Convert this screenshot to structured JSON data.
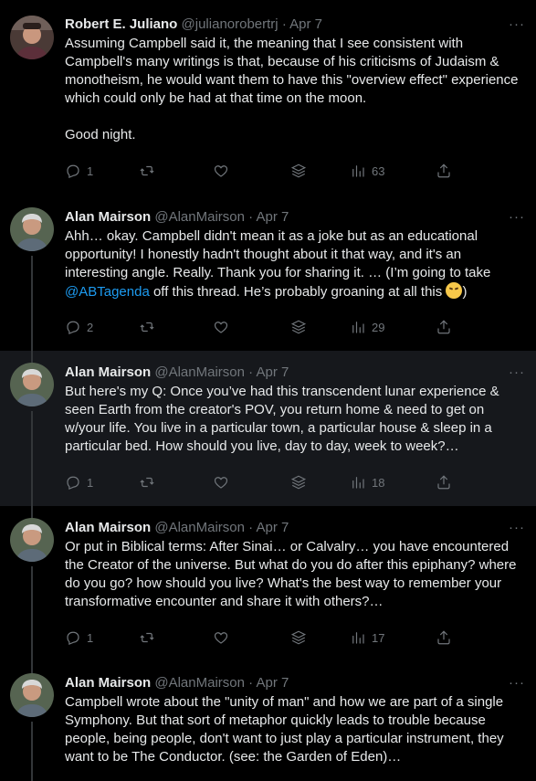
{
  "tweets": [
    {
      "name": "Robert E. Juliano",
      "handle": "@julianorobertrj",
      "sep": "·",
      "date": "Apr 7",
      "more": "···",
      "paragraphs": [
        "Assuming Campbell said it, the meaning that I see consistent with Campbell's many writings is that, because of his criticisms of Judaism & monotheism, he would want them to have this \"overview effect\" experience which could only be had at that time on the moon.",
        "Good night."
      ],
      "replies": "1",
      "retweets": "",
      "likes": "",
      "views": "63"
    },
    {
      "name": "Alan Mairson",
      "handle": "@AlanMairson",
      "sep": "·",
      "date": "Apr 7",
      "more": "···",
      "text_before": "Ahh… okay. Campbell didn't mean it as a joke but as an educational opportunity! I honestly hadn't thought about it that way, and it's an interesting angle. Really. Thank you for sharing it. … (I’m going to take ",
      "mention": "@ABTagenda",
      "text_after": " off this thread. He’s probably groaning at all this ",
      "text_end": ")",
      "replies": "2",
      "retweets": "",
      "likes": "",
      "views": "29"
    },
    {
      "name": "Alan Mairson",
      "handle": "@AlanMairson",
      "sep": "·",
      "date": "Apr 7",
      "more": "···",
      "text": "But here's my Q: Once you’ve had this transcendent lunar experience & seen Earth from the creator's POV, you return home & need to get on w/your life. You live in a particular town, a particular house & sleep in a particular bed. How should you live, day to day, week to week?…",
      "replies": "1",
      "retweets": "",
      "likes": "",
      "views": "18"
    },
    {
      "name": "Alan Mairson",
      "handle": "@AlanMairson",
      "sep": "·",
      "date": "Apr 7",
      "more": "···",
      "text": "Or put in Biblical terms: After Sinai… or Calvalry… you have encountered the Creator of the universe. But what do you do after this epiphany? where do you go? how should you live? What's the best way to remember your transformative encounter and share it with others?…",
      "replies": "1",
      "retweets": "",
      "likes": "",
      "views": "17"
    },
    {
      "name": "Alan Mairson",
      "handle": "@AlanMairson",
      "sep": "·",
      "date": "Apr 7",
      "more": "···",
      "text": "Campbell wrote about the \"unity of man\" and how we are part of a single Symphony. But that sort of metaphor quickly leads to trouble because people, being people, don't want to just play a particular instrument, they want to be The Conductor. (see: the Garden of Eden)…"
    }
  ],
  "icons": {
    "reply": "reply-icon",
    "retweet": "retweet-icon",
    "like": "heart-icon",
    "stack": "stack-icon",
    "views": "views-icon",
    "share": "share-icon"
  },
  "colors": {
    "background": "#000000",
    "highlight": "#16181c",
    "text": "#e7e9ea",
    "muted": "#71767b",
    "link": "#1d9bf0"
  }
}
